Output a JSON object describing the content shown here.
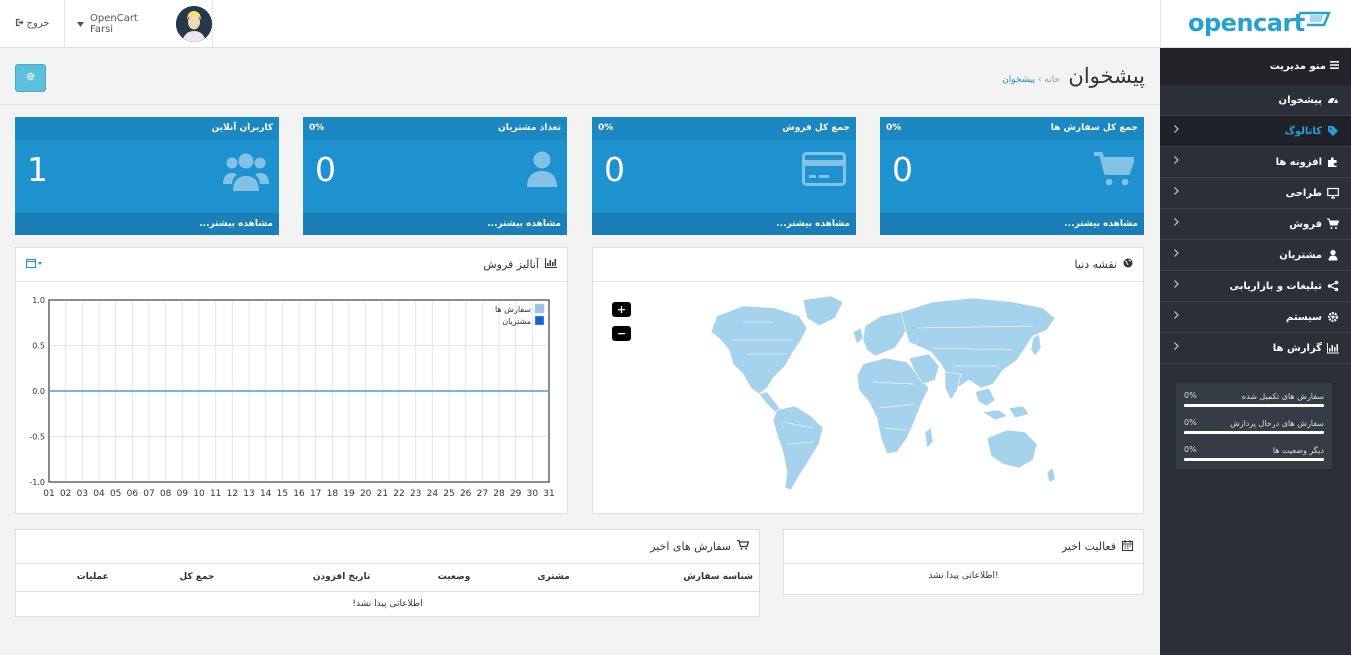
{
  "header": {
    "logo_text": "opencart",
    "logout_label": "خروج",
    "user_name": "OpenCart Farsi"
  },
  "page": {
    "title": "پیشخوان",
    "breadcrumb_home": "خانه",
    "breadcrumb_current": "پیشخوان"
  },
  "sidebar": {
    "title": "منو مدیریت",
    "items": [
      {
        "label": "پیشخوان",
        "icon": "dashboard-icon",
        "has_arrow": false
      },
      {
        "label": "کاتالوگ",
        "icon": "tags-icon",
        "has_arrow": true
      },
      {
        "label": "افزونه ها",
        "icon": "puzzle-icon",
        "has_arrow": true
      },
      {
        "label": "طراحی",
        "icon": "monitor-icon",
        "has_arrow": true
      },
      {
        "label": "فروش",
        "icon": "cart-icon",
        "has_arrow": true
      },
      {
        "label": "مشتریان",
        "icon": "user-icon",
        "has_arrow": true
      },
      {
        "label": "تبلیغات و بازاریابی",
        "icon": "share-icon",
        "has_arrow": true
      },
      {
        "label": "سیستم",
        "icon": "cog-icon",
        "has_arrow": true
      },
      {
        "label": "گزارش ها",
        "icon": "bar-chart-icon",
        "has_arrow": true
      }
    ],
    "stats": [
      {
        "label": "سفارش های تکمیل شده",
        "percent": "0%",
        "fill": 0
      },
      {
        "label": "سفارش های درحال پردازش",
        "percent": "0%",
        "fill": 0
      },
      {
        "label": "دیگر وضعیت ها",
        "percent": "0%",
        "fill": 0
      }
    ]
  },
  "tiles": [
    {
      "title": "جمع کل سفارش ها",
      "percent": "0%",
      "value": "0",
      "footer": "مشاهده بیشتر...",
      "icon": "cart-icon"
    },
    {
      "title": "جمع کل فروش",
      "percent": "0%",
      "value": "0",
      "footer": "مشاهده بیشتر...",
      "icon": "credit-card-icon"
    },
    {
      "title": "تعداد مشتریان",
      "percent": "0%",
      "value": "0",
      "footer": "مشاهده بیشتر...",
      "icon": "user-icon"
    },
    {
      "title": "کاربران آنلاین",
      "percent": "",
      "value": "1",
      "footer": "مشاهده بیشتر...",
      "icon": "users-icon"
    }
  ],
  "map_panel": {
    "title": "نقشه دنیا",
    "zoom_in": "+",
    "zoom_out": "−"
  },
  "chart_panel": {
    "title": "آنالیز فروش"
  },
  "chart_data": {
    "type": "line",
    "title": "",
    "x": [
      "01",
      "02",
      "03",
      "04",
      "05",
      "06",
      "07",
      "08",
      "09",
      "10",
      "11",
      "12",
      "13",
      "14",
      "15",
      "16",
      "17",
      "18",
      "19",
      "20",
      "21",
      "22",
      "23",
      "24",
      "25",
      "26",
      "27",
      "28",
      "29",
      "30",
      "31"
    ],
    "series": [
      {
        "name": "سفارش ها",
        "color": "#9bc2e6",
        "values": [
          0,
          0,
          0,
          0,
          0,
          0,
          0,
          0,
          0,
          0,
          0,
          0,
          0,
          0,
          0,
          0,
          0,
          0,
          0,
          0,
          0,
          0,
          0,
          0,
          0,
          0,
          0,
          0,
          0,
          0,
          0
        ]
      },
      {
        "name": "مشتریان",
        "color": "#1065d2",
        "values": [
          0,
          0,
          0,
          0,
          0,
          0,
          0,
          0,
          0,
          0,
          0,
          0,
          0,
          0,
          0,
          0,
          0,
          0,
          0,
          0,
          0,
          0,
          0,
          0,
          0,
          0,
          0,
          0,
          0,
          0,
          0
        ]
      }
    ],
    "y_ticks": [
      "1.0",
      "0.5",
      "0.0",
      "-0.5",
      "-1.0"
    ],
    "ylim": [
      -1,
      1
    ],
    "grid": true,
    "legend": "top-right"
  },
  "orders_panel": {
    "title": "سفارش های اخیر",
    "columns": [
      "شناسه سفارش",
      "مشتری",
      "وضعیت",
      "تاریخ افزودن",
      "جمع کل",
      "عملیات"
    ],
    "empty": "اطلاعاتی پیدا نشد!"
  },
  "activity_panel": {
    "title": "فعالیت اخیر",
    "empty": "اطلاعاتی پیدا نشد!"
  },
  "colors": {
    "accent": "#1e91cf",
    "sidebar": "#2b2f37",
    "info_button": "#5bc0de"
  }
}
